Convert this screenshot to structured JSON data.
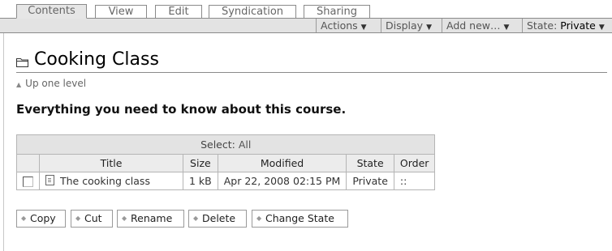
{
  "tabs": [
    "Contents",
    "View",
    "Edit",
    "Syndication",
    "Sharing"
  ],
  "actions_menu": {
    "actions": "Actions",
    "display": "Display",
    "add_new": "Add new…",
    "state_label": "State:",
    "state_value": "Private",
    "arrow": "▼"
  },
  "page": {
    "title": "Cooking Class",
    "up_level": "Up one level",
    "description": "Everything you need to know about this course."
  },
  "table": {
    "select_label": "Select:",
    "select_all": "All",
    "columns": [
      "Title",
      "Size",
      "Modified",
      "State",
      "Order"
    ],
    "rows": [
      {
        "title": "The cooking class",
        "size": "1 kB",
        "modified": "Apr 22, 2008 02:15 PM",
        "state": "Private",
        "order": "::"
      }
    ]
  },
  "buttons": [
    "Copy",
    "Cut",
    "Rename",
    "Delete",
    "Change State"
  ],
  "icons": {
    "folder": "folder-icon",
    "document": "document-icon",
    "up": "up-arrow-icon",
    "button": "button-bullet-icon"
  }
}
